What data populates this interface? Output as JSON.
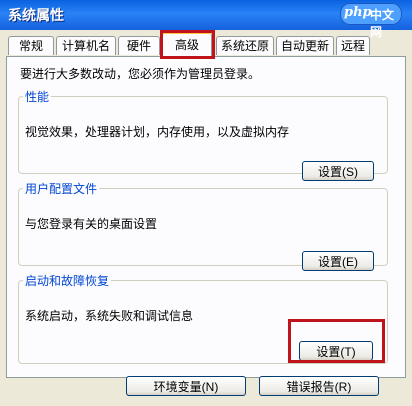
{
  "window": {
    "title": "系统属性"
  },
  "watermark": {
    "php": "php",
    "cn": "中文网"
  },
  "tabs": [
    {
      "label": "常规"
    },
    {
      "label": "计算机名"
    },
    {
      "label": "硬件"
    },
    {
      "label": "高级"
    },
    {
      "label": "系统还原"
    },
    {
      "label": "自动更新"
    },
    {
      "label": "远程"
    }
  ],
  "active_tab": "高级",
  "intro": "要进行大多数改动，您必须作为管理员登录。",
  "groups": [
    {
      "title": "性能",
      "description": "视觉效果，处理器计划，内存使用，以及虚拟内存",
      "button": "设置(S)"
    },
    {
      "title": "用户配置文件",
      "description": "与您登录有关的桌面设置",
      "button": "设置(E)"
    },
    {
      "title": "启动和故障恢复",
      "description": "系统启动，系统失败和调试信息",
      "button": "设置(T)"
    }
  ],
  "bottom_buttons": [
    {
      "label": "环境变量(N)"
    },
    {
      "label": "错误报告(R)"
    }
  ],
  "colors": {
    "title_bar": "#0a62e0",
    "highlight_box": "#c0141c",
    "group_title": "#0046d5"
  }
}
